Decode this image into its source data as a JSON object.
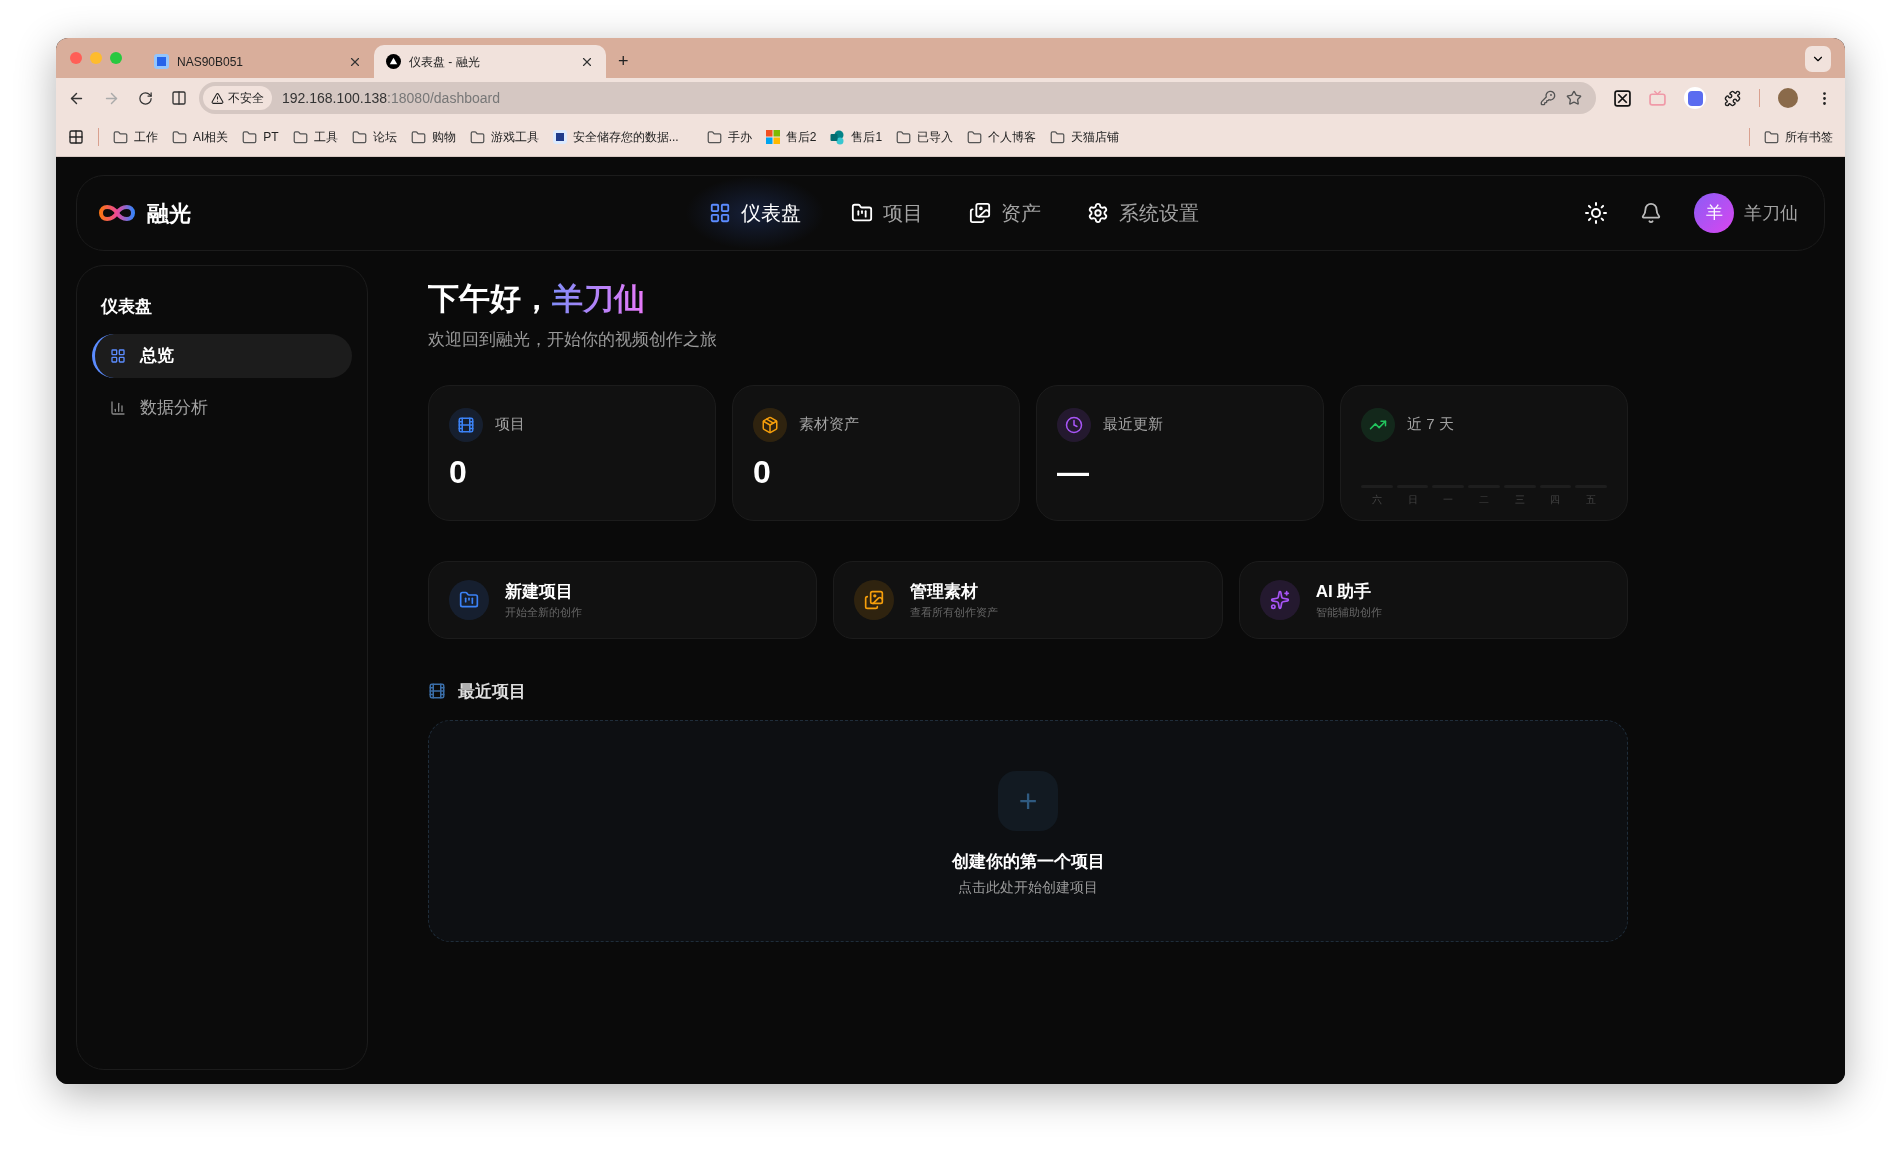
{
  "browser": {
    "tabs": [
      {
        "title": "NAS90B051",
        "selected": false,
        "kind": "nas"
      },
      {
        "title": "仪表盘 - 融光",
        "selected": true,
        "kind": "app"
      }
    ],
    "new_tab": "+",
    "security": "不安全",
    "url_host": "192.168.100.138",
    "url_rest": ":18080/dashboard",
    "bookmarks": [
      {
        "label": "工作",
        "kind": "folder"
      },
      {
        "label": "AI相关",
        "kind": "folder"
      },
      {
        "label": "PT",
        "kind": "folder"
      },
      {
        "label": "工具",
        "kind": "folder"
      },
      {
        "label": "论坛",
        "kind": "folder"
      },
      {
        "label": "购物",
        "kind": "folder"
      },
      {
        "label": "游戏工具",
        "kind": "folder"
      },
      {
        "label": "安全储存您的数据...",
        "kind": "nas"
      },
      {
        "label": "手办",
        "kind": "folder"
      },
      {
        "label": "售后2",
        "kind": "tiles"
      },
      {
        "label": "售后1",
        "kind": "share"
      },
      {
        "label": "已导入",
        "kind": "folder"
      },
      {
        "label": "个人博客",
        "kind": "folder"
      },
      {
        "label": "天猫店铺",
        "kind": "folder"
      }
    ],
    "all_bookmarks": "所有书签"
  },
  "header": {
    "brand": "融光",
    "nav": [
      {
        "label": "仪表盘",
        "selected": true
      },
      {
        "label": "项目",
        "selected": false
      },
      {
        "label": "资产",
        "selected": false
      },
      {
        "label": "系统设置",
        "selected": false
      }
    ],
    "avatar": "羊",
    "user_name": "羊刀仙"
  },
  "sidebar": {
    "title": "仪表盘",
    "items": [
      {
        "label": "总览",
        "selected": true
      },
      {
        "label": "数据分析",
        "selected": false
      }
    ]
  },
  "greeting": {
    "prefix": "下午好，",
    "name": "羊刀仙"
  },
  "subtitle": "欢迎回到融光，开始你的视频创作之旅",
  "stats": [
    {
      "label": "项目",
      "value": "0",
      "color": "#3b82f6"
    },
    {
      "label": "素材资产",
      "value": "0",
      "color": "#f59e0b"
    },
    {
      "label": "最近更新",
      "value": "—",
      "color": "#a855f7"
    }
  ],
  "weekly": {
    "label": "近 7 天",
    "color": "#22c55e",
    "days": [
      "六",
      "日",
      "一",
      "二",
      "三",
      "四",
      "五"
    ]
  },
  "actions": [
    {
      "title": "新建项目",
      "subtitle": "开始全新的创作",
      "color": "#3b82f6"
    },
    {
      "title": "管理素材",
      "subtitle": "查看所有创作资产",
      "color": "#f59e0b"
    },
    {
      "title": "AI 助手",
      "subtitle": "智能辅助创作",
      "color": "#a855f7"
    }
  ],
  "recent": {
    "title": "最近项目",
    "empty_title": "创建你的第一个项目",
    "empty_subtitle": "点击此处开始创建项目",
    "add": "+"
  }
}
